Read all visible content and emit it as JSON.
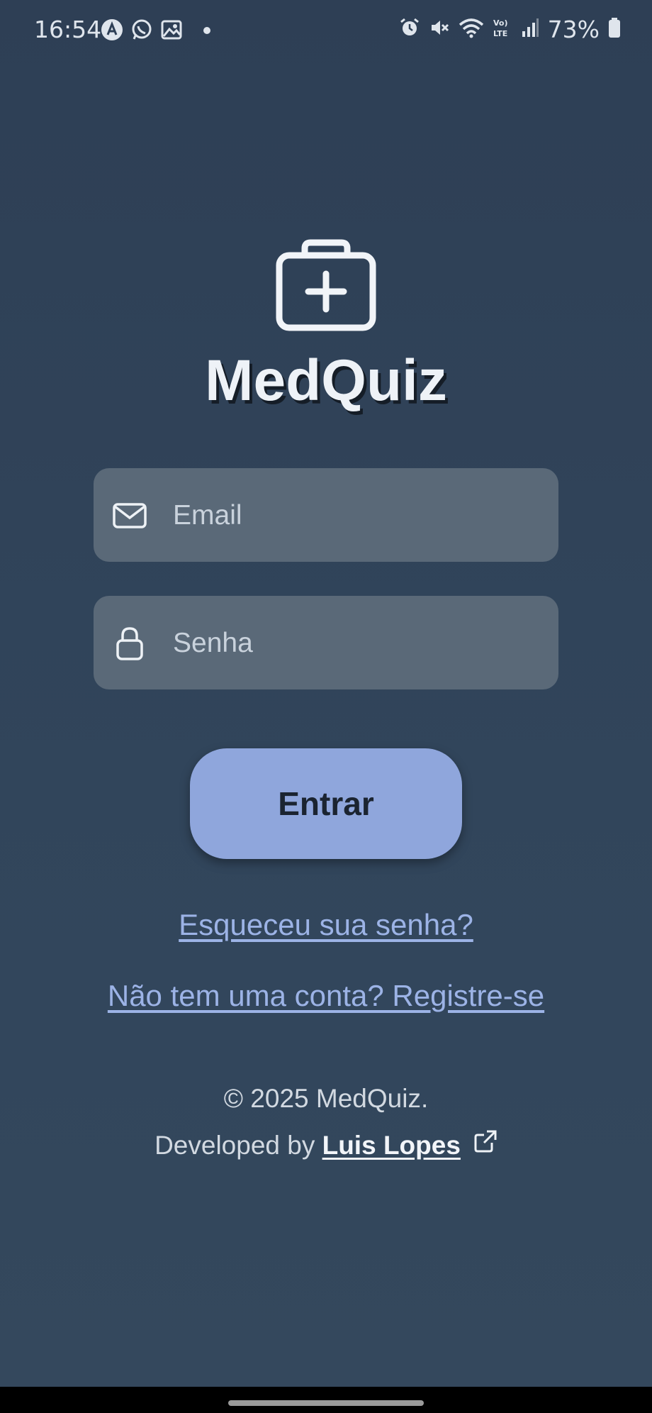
{
  "status_bar": {
    "time": "16:54",
    "battery": "73%",
    "left_icons": [
      "app-notification-icon",
      "whatsapp-icon",
      "gallery-icon",
      "dot-icon"
    ],
    "right_icons": [
      "alarm-icon",
      "mute-icon",
      "wifi-icon",
      "volte-icon",
      "signal-icon",
      "battery-icon"
    ]
  },
  "app": {
    "title": "MedQuiz",
    "logo_icon": "medical-kit-icon"
  },
  "login_form": {
    "email_placeholder": "Email",
    "email_value": "",
    "password_placeholder": "Senha",
    "password_value": "",
    "submit_label": "Entrar"
  },
  "links": {
    "forgot_password": "Esqueceu sua senha?",
    "register": "Não tem uma conta? Registre-se"
  },
  "footer": {
    "copyright": "© 2025 MedQuiz.",
    "developed_by": "Developed by ",
    "author": "Luis Lopes"
  },
  "colors": {
    "background": "#31455b",
    "input_bg": "#5a6978",
    "button_bg": "#8fa6dc",
    "link": "#9cb3e6"
  }
}
